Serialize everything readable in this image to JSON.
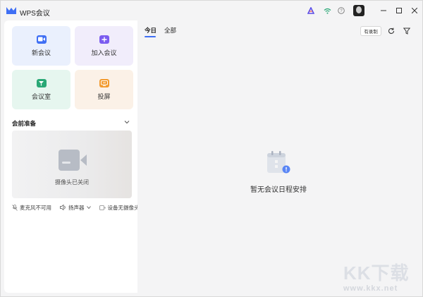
{
  "app": {
    "title": "WPS会议"
  },
  "titlebar_icons": [
    "ai-icon",
    "wifi-icon",
    "help-icon",
    "avatar"
  ],
  "tiles": [
    {
      "label": "新会议",
      "icon": "video-camera-icon",
      "bg": "#eaf0fd",
      "color": "#3f6ff4"
    },
    {
      "label": "加入会议",
      "icon": "plus-icon",
      "bg": "#f1edfb",
      "color": "#7b5cf0"
    },
    {
      "label": "会议室",
      "icon": "meeting-room-icon",
      "bg": "#e6f6ef",
      "color": "#2aa876"
    },
    {
      "label": "投屏",
      "icon": "screen-cast-icon",
      "bg": "#fbf1e7",
      "color": "#f29a2e"
    }
  ],
  "pre_meeting": {
    "title": "会前准备",
    "camera_status": "摄像头已关闭",
    "mic": "麦克风不可用",
    "speaker": "扬声器",
    "camera_device": "设备无摄像头"
  },
  "tabs": [
    {
      "label": "今日",
      "active": true
    },
    {
      "label": "全部",
      "active": false
    }
  ],
  "toolbar": {
    "record_label": "有录制"
  },
  "empty_state": {
    "text": "暂无会议日程安排"
  },
  "watermark": {
    "brand": "KK下载",
    "url": "www.kkx.net"
  },
  "colors": {
    "accent": "#3f6ff4"
  }
}
